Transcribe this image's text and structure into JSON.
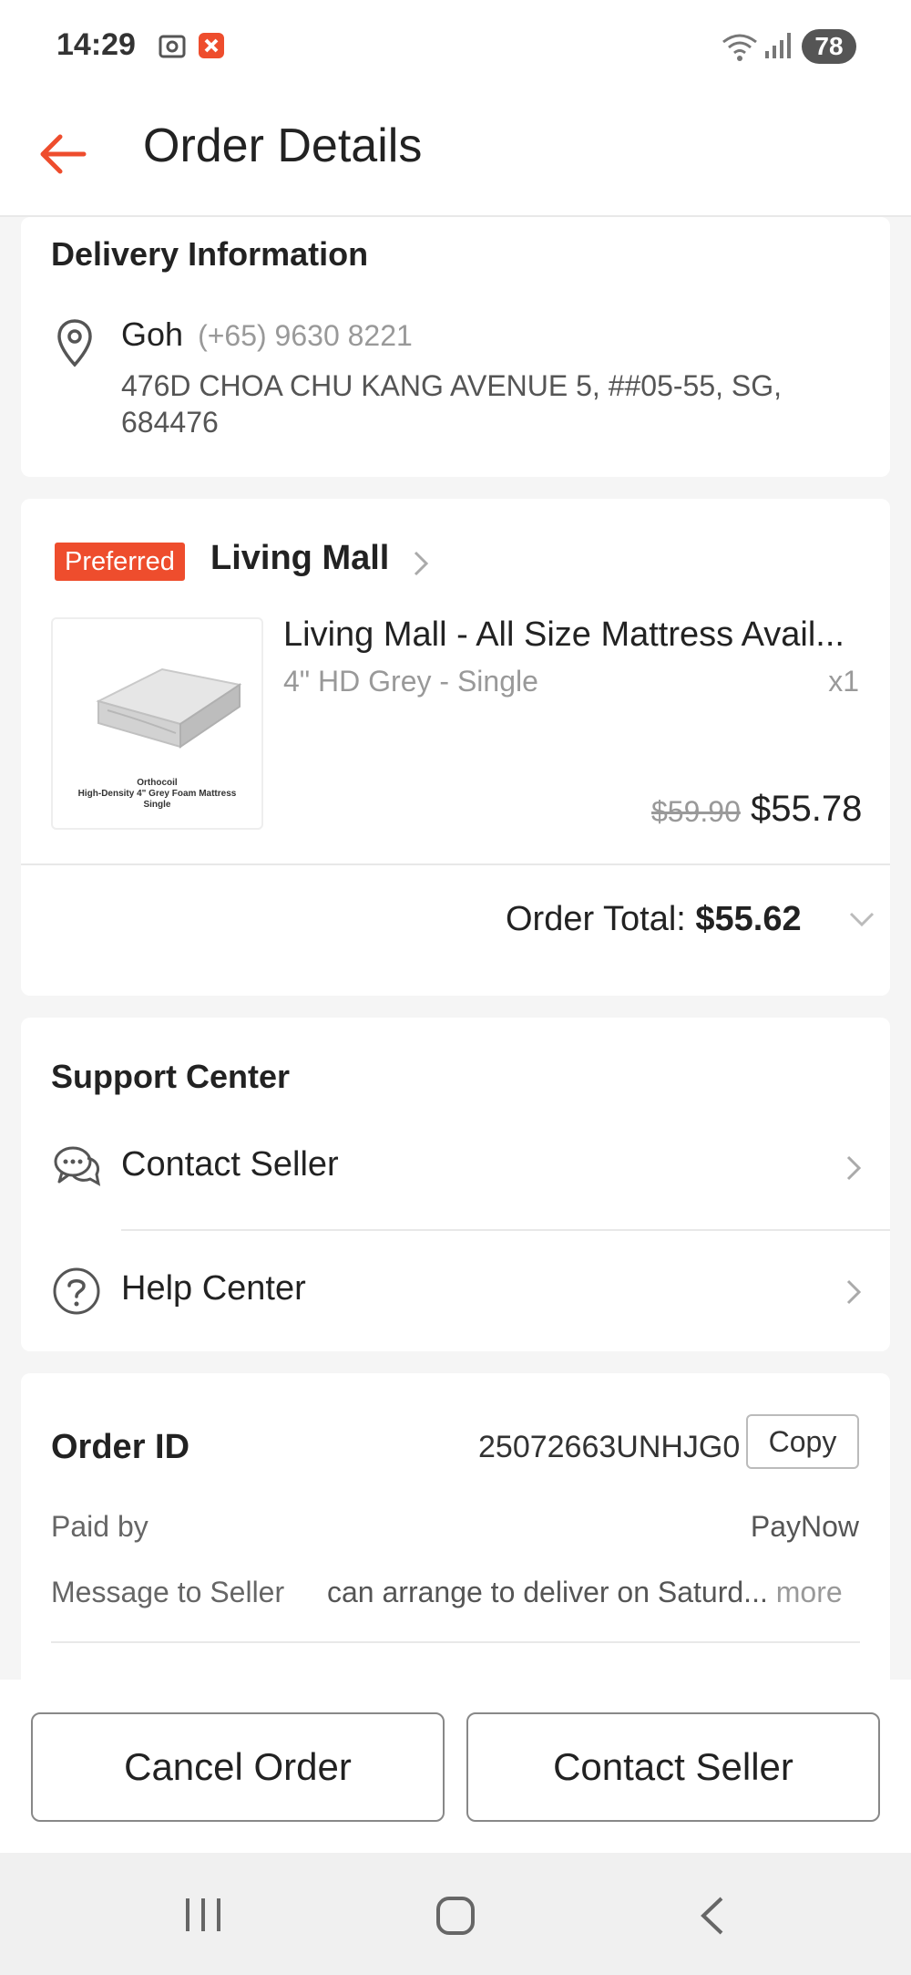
{
  "status_bar": {
    "time": "14:29",
    "battery": "78",
    "icons": [
      "screenshot-icon",
      "notification-alert-icon",
      "wifi-icon",
      "signal-icon"
    ]
  },
  "header": {
    "title": "Order Details",
    "back_icon": "back-arrow-icon"
  },
  "delivery": {
    "title": "Delivery Information",
    "name": "Goh",
    "phone": "(+65) 9630 8221",
    "address": "476D CHOA CHU KANG AVENUE 5, ##05-55, SG, 684476"
  },
  "shop": {
    "badge": "Preferred",
    "name": "Living Mall",
    "product": {
      "name": "Living Mall - All Size Mattress Avail...",
      "variant": "4\" HD Grey - Single",
      "qty": "x1",
      "price_original": "$59.90",
      "price": "$55.78",
      "image_caption_line1": "Orthocoil",
      "image_caption_line2": "High-Density 4\" Grey Foam Mattress",
      "image_caption_line3": "Single"
    },
    "order_total_label": "Order Total:",
    "order_total_value": "$55.62"
  },
  "support": {
    "title": "Support Center",
    "items": [
      {
        "label": "Contact Seller",
        "icon": "chat-bubbles-icon"
      },
      {
        "label": "Help Center",
        "icon": "question-circle-icon"
      }
    ]
  },
  "order_info": {
    "order_id_label": "Order ID",
    "order_id": "25072663UNHJG0",
    "copy_label": "Copy",
    "paid_by_label": "Paid by",
    "paid_by": "PayNow",
    "message_label": "Message to Seller",
    "message": "can arrange to deliver on Saturd...",
    "more_label": "more"
  },
  "actions": {
    "cancel_label": "Cancel Order",
    "contact_label": "Contact Seller"
  },
  "colors": {
    "accent": "#ee4d2d",
    "background": "#f5f5f5"
  }
}
